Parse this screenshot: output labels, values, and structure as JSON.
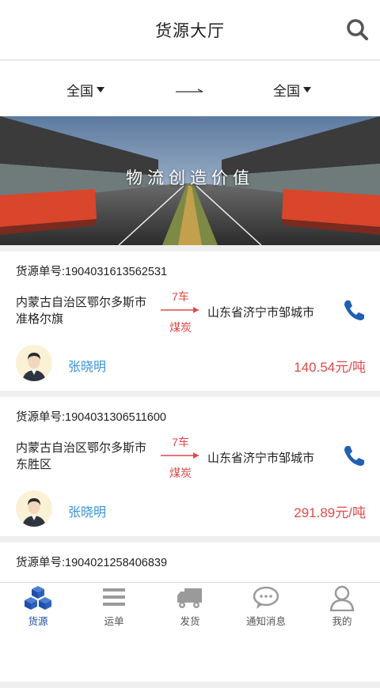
{
  "header": {
    "title": "货源大厅",
    "search_icon": "search-icon"
  },
  "route": {
    "origin": "全国",
    "destination": "全国"
  },
  "banner": {
    "slogan": "物流创造价值"
  },
  "colors": {
    "accent": "#1f4fa8",
    "price": "#e04848",
    "name": "#3b93d6"
  },
  "cards": [
    {
      "order_no": "货源单号:1904031613562531",
      "from": "内蒙古自治区鄂尔多斯市准格尔旗",
      "count": "7车",
      "goods": "煤炭",
      "to": "山东省济宁市邹城市",
      "name": "张晓明",
      "price": "140.54元/吨"
    },
    {
      "order_no": "货源单号:1904031306511600",
      "from": "内蒙古自治区鄂尔多斯市东胜区",
      "count": "7车",
      "goods": "煤炭",
      "to": "山东省济宁市邹城市",
      "name": "张晓明",
      "price": "291.89元/吨"
    },
    {
      "order_no": "货源单号:1904021258406839",
      "from": "",
      "count": "",
      "goods": "",
      "to": "",
      "name": "",
      "price": ""
    }
  ],
  "tabs": [
    {
      "label": "货源",
      "icon": "cubes-icon",
      "active": true
    },
    {
      "label": "运单",
      "icon": "list-icon",
      "active": false
    },
    {
      "label": "发货",
      "icon": "truck-icon",
      "active": false
    },
    {
      "label": "通知消息",
      "icon": "message-icon",
      "active": false
    },
    {
      "label": "我的",
      "icon": "user-icon",
      "active": false
    }
  ]
}
